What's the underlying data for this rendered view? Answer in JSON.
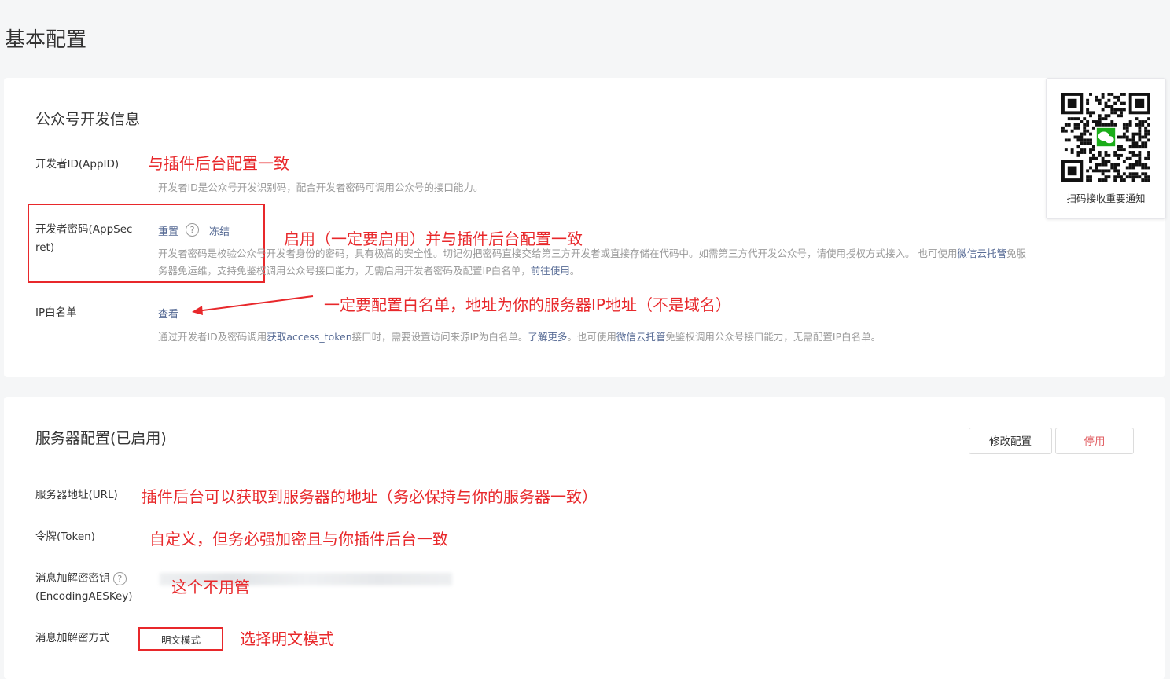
{
  "page_title": "基本配置",
  "dev_info": {
    "section_title": "公众号开发信息",
    "appid": {
      "label": "开发者ID(AppID)",
      "desc": "开发者ID是公众号开发识别码，配合开发者密码可调用公众号的接口能力。",
      "annotation": "与插件后台配置一致"
    },
    "appsecret": {
      "label_line1": "开发者密码(AppSec",
      "label_line2": "ret)",
      "reset": "重置",
      "freeze": "冻结",
      "help": "?",
      "desc_part1": "开发者密码是校验公众号开发者身份的密码，具有极高的安全性。切记勿把密码直接交给第三方开发者或直接存储在代码中。如需第三方代开发公众号，请使用授权方式接入。 也可使用",
      "desc_link1": "微信云托管",
      "desc_part2": "免服",
      "desc_line2_part1": "务器免运维，支持免鉴权调用公众号接口能力，无需启用开发者密码及配置IP白名单，",
      "desc_link2": "前往使用",
      "desc_line2_end": "。",
      "annotation": "启用（一定要启用）并与插件后台配置一致"
    },
    "ip_whitelist": {
      "label": "IP白名单",
      "view": "查看",
      "desc_part1": "通过开发者ID及密码调用",
      "desc_link1": "获取access_token",
      "desc_part2": "接口时，需要设置访问来源IP为白名单。",
      "desc_link2": "了解更多",
      "desc_part3": "。也可使用",
      "desc_link3": "微信云托管",
      "desc_part4": "免鉴权调用公众号接口能力，无需配置IP白名单。",
      "annotation": "一定要配置白名单，地址为你的服务器IP地址（不是域名）"
    }
  },
  "qr": {
    "caption": "扫码接收重要通知"
  },
  "server_config": {
    "section_title": "服务器配置(已启用)",
    "modify_button": "修改配置",
    "disable_button": "停用",
    "url": {
      "label": "服务器地址(URL)",
      "annotation": "插件后台可以获取到服务器的地址（务必保持与你的服务器一致）"
    },
    "token": {
      "label": "令牌(Token)",
      "annotation": "自定义，但务必强加密且与你插件后台一致"
    },
    "aeskey": {
      "label_line1": "消息加解密密钥",
      "label_line2": "(EncodingAESKey)",
      "help": "?",
      "annotation": "这个不用管"
    },
    "encrypt_mode": {
      "label": "消息加解密方式",
      "value": "明文模式",
      "annotation": "选择明文模式"
    }
  },
  "colors": {
    "annotation_red": "#e8282b",
    "link_blue": "#576b95",
    "disable_red": "#e15f63",
    "qr_green": "#1aad19"
  }
}
